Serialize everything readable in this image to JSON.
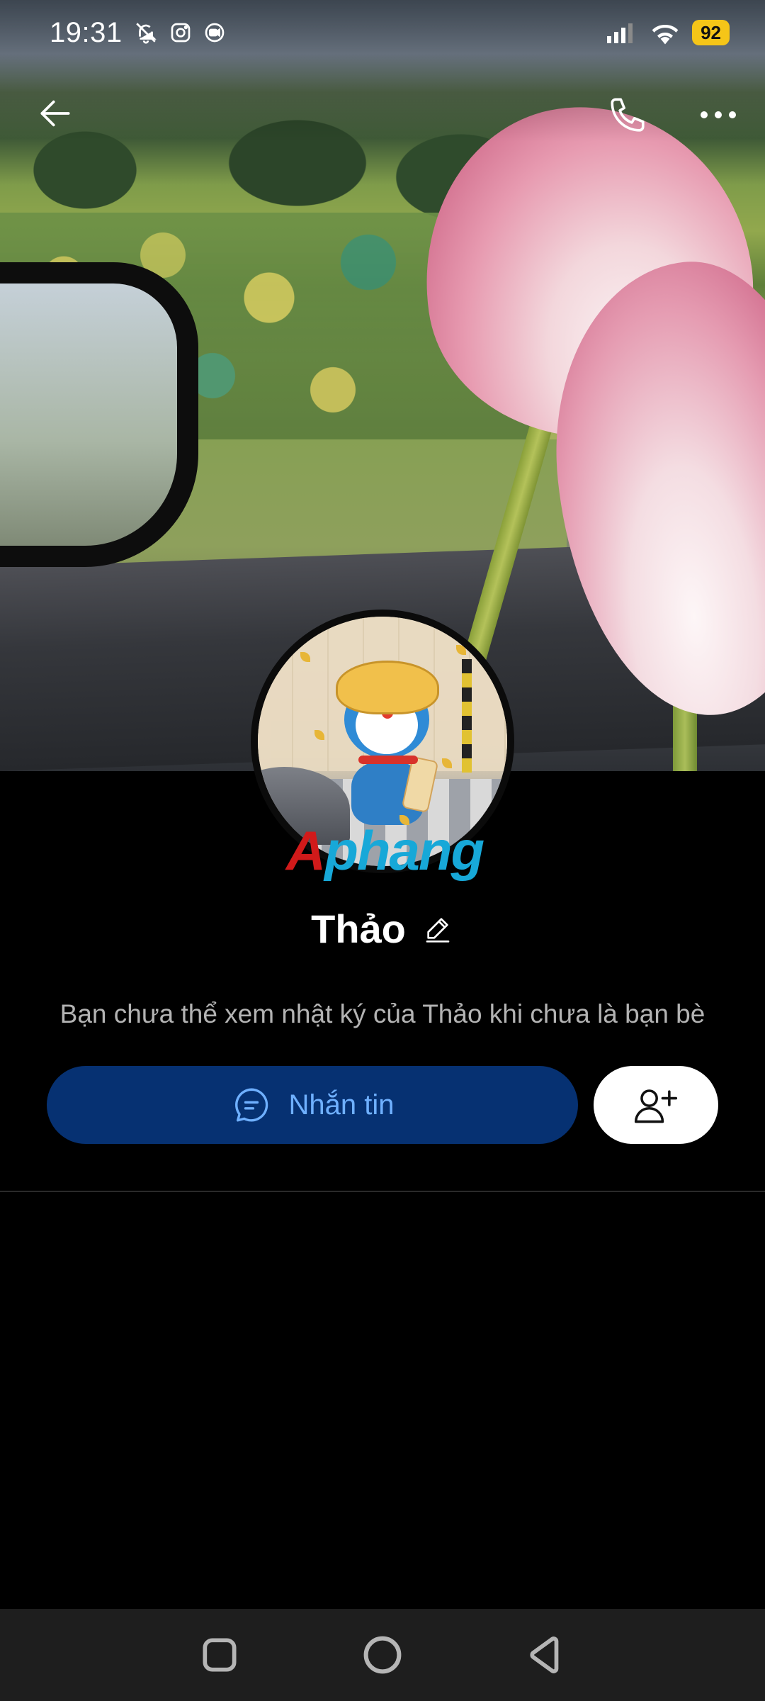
{
  "status_bar": {
    "time": "19:31",
    "battery": "92",
    "icons": [
      "bell-mute-icon",
      "instagram-icon",
      "screen-record-icon",
      "signal-icon",
      "wifi-icon",
      "battery-icon"
    ]
  },
  "top_nav": {
    "icons": [
      "back-arrow-icon",
      "phone-icon",
      "more-icon"
    ]
  },
  "profile": {
    "name": "Thảo",
    "privacy_note": "Bạn chưa thể xem nhật ký của Thảo khi chưa là bạn bè",
    "watermark_first": "A",
    "watermark_rest": "phang"
  },
  "actions": {
    "message_label": "Nhắn tin",
    "message_icon": "chat-bubble-icon",
    "add_friend_icon": "add-user-icon"
  },
  "colors": {
    "message_button_bg": "#063172",
    "message_button_text": "#6fb0ff",
    "battery_badge": "#f5c518"
  },
  "system_nav": {
    "icons": [
      "recents-icon",
      "home-icon",
      "back-icon"
    ]
  }
}
